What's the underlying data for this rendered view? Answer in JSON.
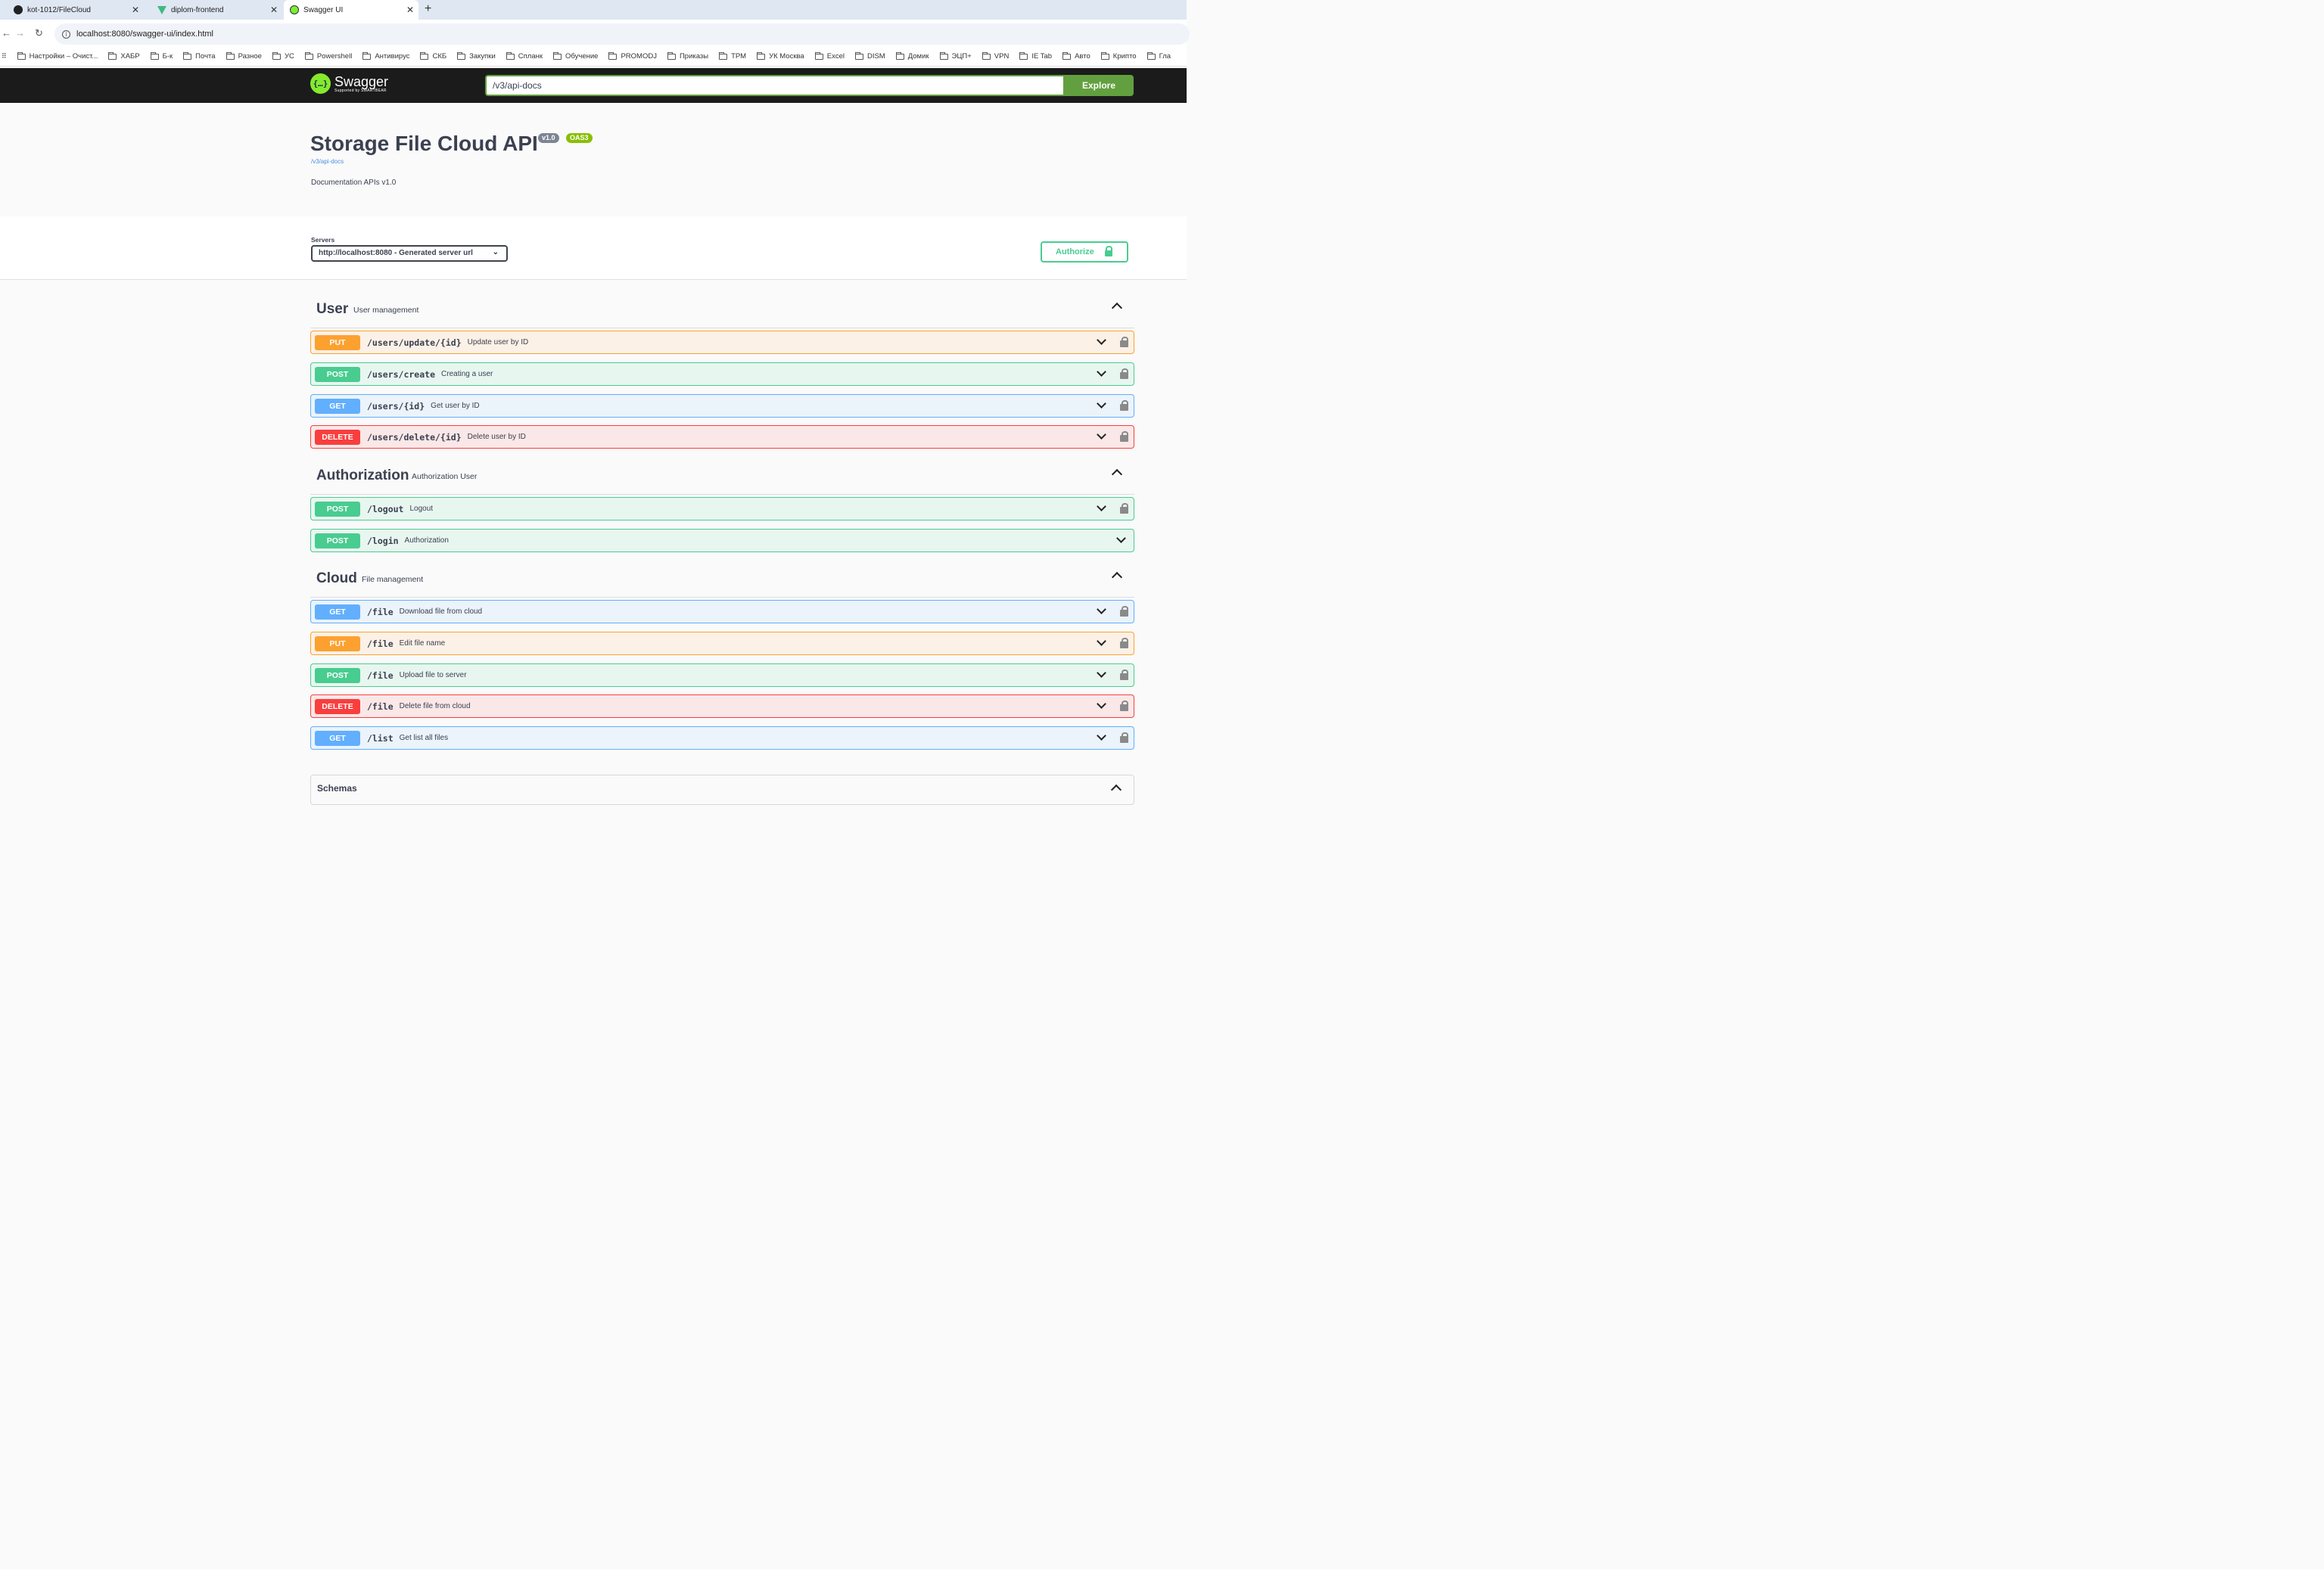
{
  "browser": {
    "tabs": [
      {
        "label": "kot-1012/FileCloud",
        "icon": "github-icon"
      },
      {
        "label": "diplom-frontend",
        "icon": "vue-icon"
      },
      {
        "label": "Swagger UI",
        "icon": "swagger-icon"
      }
    ],
    "url": "localhost:8080/swagger-ui/index.html",
    "bookmarks": [
      "Настройки – Очист...",
      "ХАБР",
      "Б-к",
      "Почта",
      "Разное",
      "УС",
      "Powershell",
      "Антивирус",
      "СКБ",
      "Закупки",
      "Спланк",
      "Обучение",
      "PROMODJ",
      "Приказы",
      "ТРМ",
      "УК Москва",
      "Excel",
      "DISM",
      "Домик",
      "ЭЦП+",
      "VPN",
      "IE Tab",
      "Авто",
      "Крипто",
      "Гла"
    ]
  },
  "topbar": {
    "logo_title": "Swagger",
    "logo_subtitle": "Supported by SMARTBEAR",
    "url_value": "/v3/api-docs",
    "explore_label": "Explore"
  },
  "info": {
    "title": "Storage File Cloud API",
    "version": "v1.0",
    "oas": "OAS3",
    "spec_link": "/v3/api-docs",
    "description": "Documentation APIs v1.0"
  },
  "servers": {
    "label": "Servers",
    "selected": "http://localhost:8080 - Generated server url",
    "authorize_label": "Authorize"
  },
  "tags": [
    {
      "name": "User",
      "description": "User management"
    },
    {
      "name": "Authorization",
      "description": "Authorization User"
    },
    {
      "name": "Cloud",
      "description": "File management"
    }
  ],
  "operations": [
    {
      "method": "PUT",
      "path": "/users/update/{id}",
      "summary": "Update user by ID"
    },
    {
      "method": "POST",
      "path": "/users/create",
      "summary": "Creating a user"
    },
    {
      "method": "GET",
      "path": "/users/{id}",
      "summary": "Get user by ID"
    },
    {
      "method": "DELETE",
      "path": "/users/delete/{id}",
      "summary": "Delete user by ID"
    },
    {
      "method": "POST",
      "path": "/logout",
      "summary": "Logout"
    },
    {
      "method": "POST",
      "path": "/login",
      "summary": "Authorization"
    },
    {
      "method": "GET",
      "path": "/file",
      "summary": "Download file from cloud"
    },
    {
      "method": "PUT",
      "path": "/file",
      "summary": "Edit file name"
    },
    {
      "method": "POST",
      "path": "/file",
      "summary": "Upload file to server"
    },
    {
      "method": "DELETE",
      "path": "/file",
      "summary": "Delete file from cloud"
    },
    {
      "method": "GET",
      "path": "/list",
      "summary": "Get list all files"
    }
  ],
  "schemas_label": "Schemas",
  "colors": {
    "put": "#fca130",
    "post": "#49cc90",
    "get": "#61affe",
    "delete": "#f93e3e",
    "explore": "#62a03f",
    "topbar": "#1b1b1b"
  }
}
